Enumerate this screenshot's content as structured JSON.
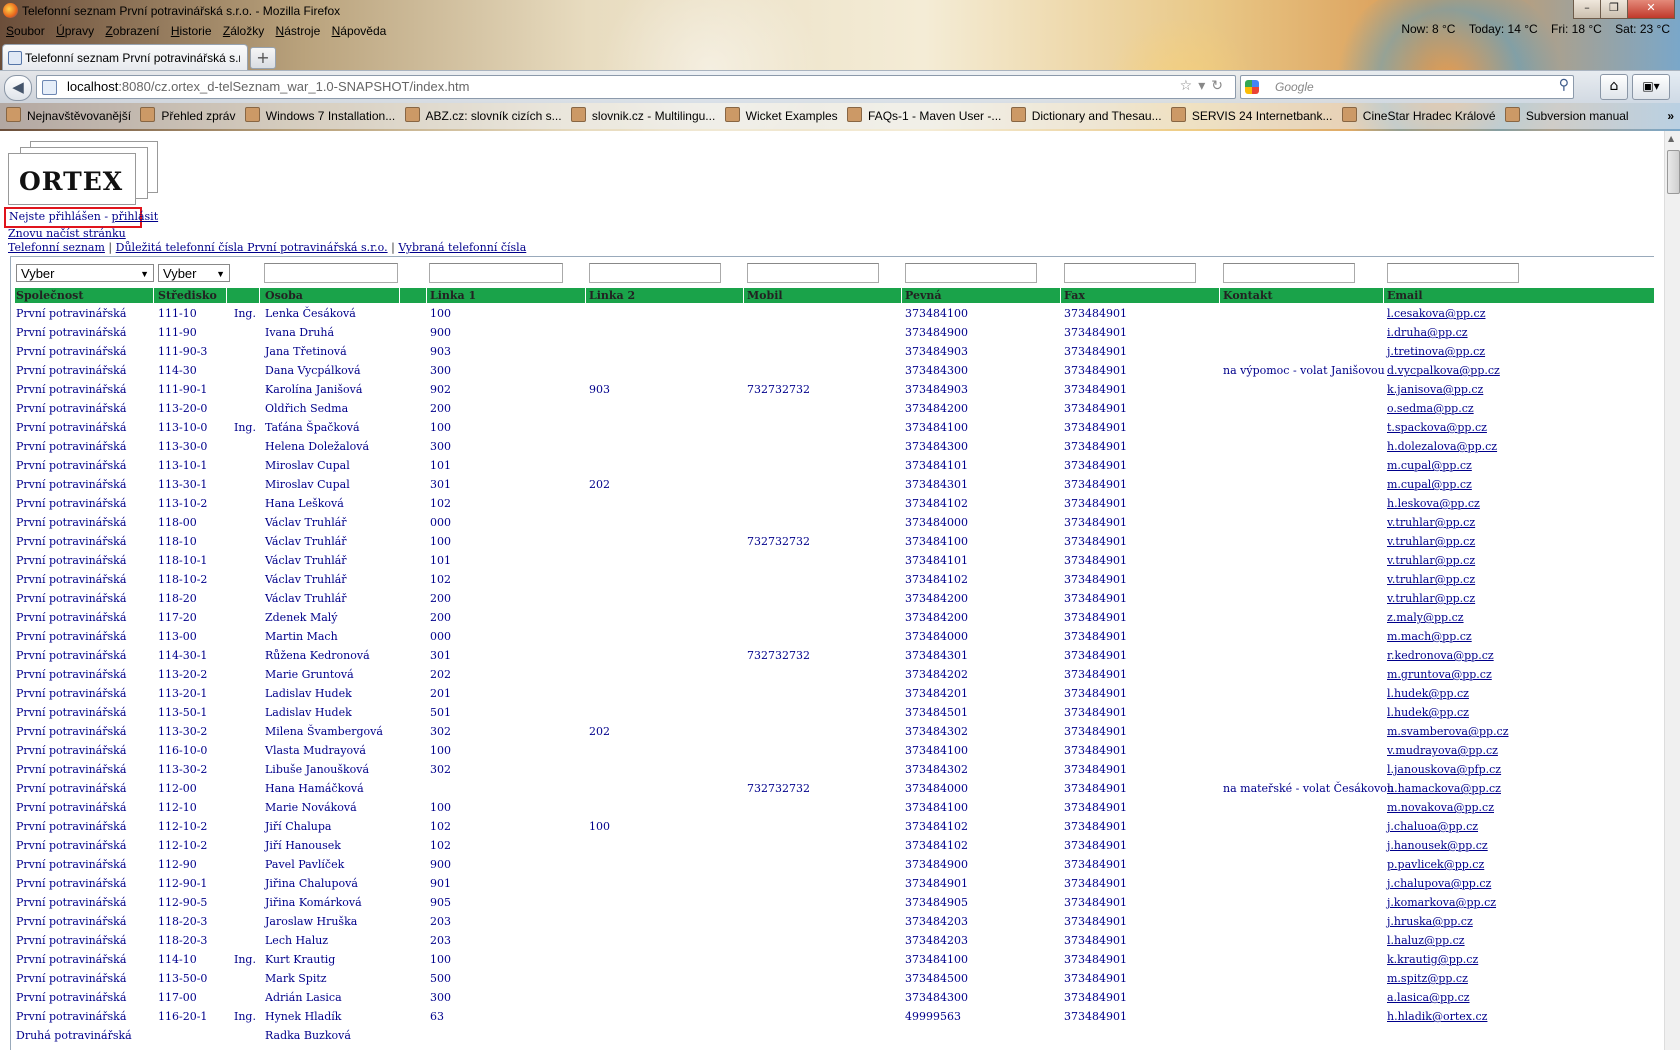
{
  "browser": {
    "window_title": "Telefonní seznam První potravinářská s.r.o. - Mozilla Firefox",
    "menu": [
      "Soubor",
      "Úpravy",
      "Zobrazení",
      "Historie",
      "Záložky",
      "Nástroje",
      "Nápověda"
    ],
    "weather": {
      "now": "Now: 8 °C",
      "today": "Today: 14 °C",
      "fri": "Fri: 18 °C",
      "sat": "Sat: 23 °C"
    },
    "tab_title": "Telefonní seznam První potravinářská s.r...",
    "new_tab": "+",
    "url_host": "localhost",
    "url_rest": ":8080/cz.ortex_d-telSeznam_war_1.0-SNAPSHOT/index.htm",
    "search_placeholder": "Google",
    "bookmarks": [
      "Nejnavštěvovanější",
      "Přehled zpráv",
      "Windows 7 Installation...",
      "ABZ.cz: slovník cizích s...",
      "slovnik.cz - Multilingu...",
      "Wicket Examples",
      "FAQs-1 - Maven User -...",
      "Dictionary and Thesau...",
      "SERVIS 24 Internetbank...",
      "CineStar Hradec Králové",
      "Subversion manual"
    ],
    "bookmarks_more": "»",
    "window_buttons": {
      "minimize": "–",
      "restore": "❐",
      "close": "✕"
    }
  },
  "page": {
    "logo_text": "ORTEX",
    "login_status": "Nejste přihlášen - ",
    "login_link": "přihlásit",
    "reload_link": "Znovu načíst stránku",
    "nav": [
      "Telefonní seznam",
      "Důležitá telefonní čísla První potravinářská s.r.o.",
      "Vybraná telefonní čísla"
    ],
    "nav_sep": "|",
    "filters": {
      "company": "Vyber",
      "center": "Vyber"
    },
    "headers": {
      "company": "Společnost",
      "center": "Středisko",
      "title": "",
      "person": "Osoba",
      "line1": "Linka 1",
      "line2": "Linka 2",
      "mobile": "Mobil",
      "landline": "Pevná",
      "fax": "Fax",
      "contact": "Kontakt",
      "email": "Email"
    },
    "rows": [
      [
        "První potravinářská",
        "111-10",
        "Ing.",
        "Lenka Česáková",
        "100",
        "",
        "",
        "373484100",
        "373484901",
        "",
        "l.cesakova@pp.cz"
      ],
      [
        "První potravinářská",
        "111-90",
        "",
        "Ivana Druhá",
        "900",
        "",
        "",
        "373484900",
        "373484901",
        "",
        "i.druha@pp.cz"
      ],
      [
        "První potravinářská",
        "111-90-3",
        "",
        "Jana Třetinová",
        "903",
        "",
        "",
        "373484903",
        "373484901",
        "",
        "j.tretinova@pp.cz"
      ],
      [
        "První potravinářská",
        "114-30",
        "",
        "Dana Vycpálková",
        "300",
        "",
        "",
        "373484300",
        "373484901",
        "na výpomoc - volat Janišovou",
        "d.vycpalkova@pp.cz"
      ],
      [
        "První potravinářská",
        "111-90-1",
        "",
        "Karolína Janišová",
        "902",
        "903",
        "732732732",
        "373484903",
        "373484901",
        "",
        "k.janisova@pp.cz"
      ],
      [
        "První potravinářská",
        "113-20-0",
        "",
        "Oldřich Sedma",
        "200",
        "",
        "",
        "373484200",
        "373484901",
        "",
        "o.sedma@pp.cz"
      ],
      [
        "První potravinářská",
        "113-10-0",
        "Ing.",
        "Taťána Špačková",
        "100",
        "",
        "",
        "373484100",
        "373484901",
        "",
        "t.spackova@pp.cz"
      ],
      [
        "První potravinářská",
        "113-30-0",
        "",
        "Helena Doležalová",
        "300",
        "",
        "",
        "373484300",
        "373484901",
        "",
        "h.dolezalova@pp.cz"
      ],
      [
        "První potravinářská",
        "113-10-1",
        "",
        "Miroslav Cupal",
        "101",
        "",
        "",
        "373484101",
        "373484901",
        "",
        "m.cupal@pp.cz"
      ],
      [
        "První potravinářská",
        "113-30-1",
        "",
        "Miroslav Cupal",
        "301",
        "202",
        "",
        "373484301",
        "373484901",
        "",
        "m.cupal@pp.cz"
      ],
      [
        "První potravinářská",
        "113-10-2",
        "",
        "Hana Lešková",
        "102",
        "",
        "",
        "373484102",
        "373484901",
        "",
        "h.leskova@pp.cz"
      ],
      [
        "První potravinářská",
        "118-00",
        "",
        "Václav Truhlář",
        "000",
        "",
        "",
        "373484000",
        "373484901",
        "",
        "v.truhlar@pp.cz"
      ],
      [
        "První potravinářská",
        "118-10",
        "",
        "Václav Truhlář",
        "100",
        "",
        "732732732",
        "373484100",
        "373484901",
        "",
        "v.truhlar@pp.cz"
      ],
      [
        "První potravinářská",
        "118-10-1",
        "",
        "Václav Truhlář",
        "101",
        "",
        "",
        "373484101",
        "373484901",
        "",
        "v.truhlar@pp.cz"
      ],
      [
        "První potravinářská",
        "118-10-2",
        "",
        "Václav Truhlář",
        "102",
        "",
        "",
        "373484102",
        "373484901",
        "",
        "v.truhlar@pp.cz"
      ],
      [
        "První potravinářská",
        "118-20",
        "",
        "Václav Truhlář",
        "200",
        "",
        "",
        "373484200",
        "373484901",
        "",
        "v.truhlar@pp.cz"
      ],
      [
        "První potravinářská",
        "117-20",
        "",
        "Zdenek Malý",
        "200",
        "",
        "",
        "373484200",
        "373484901",
        "",
        "z.maly@pp.cz"
      ],
      [
        "První potravinářská",
        "113-00",
        "",
        "Martin Mach",
        "000",
        "",
        "",
        "373484000",
        "373484901",
        "",
        "m.mach@pp.cz"
      ],
      [
        "První potravinářská",
        "114-30-1",
        "",
        "Růžena Kedronová",
        "301",
        "",
        "732732732",
        "373484301",
        "373484901",
        "",
        "r.kedronova@pp.cz"
      ],
      [
        "První potravinářská",
        "113-20-2",
        "",
        "Marie Gruntová",
        "202",
        "",
        "",
        "373484202",
        "373484901",
        "",
        "m.gruntova@pp.cz"
      ],
      [
        "První potravinářská",
        "113-20-1",
        "",
        "Ladislav Hudek",
        "201",
        "",
        "",
        "373484201",
        "373484901",
        "",
        "l.hudek@pp.cz"
      ],
      [
        "První potravinářská",
        "113-50-1",
        "",
        "Ladislav Hudek",
        "501",
        "",
        "",
        "373484501",
        "373484901",
        "",
        "l.hudek@pp.cz"
      ],
      [
        "První potravinářská",
        "113-30-2",
        "",
        "Milena Švambergová",
        "302",
        "202",
        "",
        "373484302",
        "373484901",
        "",
        "m.svamberova@pp.cz"
      ],
      [
        "První potravinářská",
        "116-10-0",
        "",
        "Vlasta Mudrayová",
        "100",
        "",
        "",
        "373484100",
        "373484901",
        "",
        "v.mudrayova@pp.cz"
      ],
      [
        "První potravinářská",
        "113-30-2",
        "",
        "Libuše Janoušková",
        "302",
        "",
        "",
        "373484302",
        "373484901",
        "",
        "l.janouskova@pfp.cz"
      ],
      [
        "První potravinářská",
        "112-00",
        "",
        "Hana Hamáčková",
        "",
        "",
        "732732732",
        "373484000",
        "373484901",
        "na mateřské - volat Česákovou",
        "h.hamackova@pp.cz"
      ],
      [
        "První potravinářská",
        "112-10",
        "",
        "Marie Nováková",
        "100",
        "",
        "",
        "373484100",
        "373484901",
        "",
        "m.novakova@pp.cz"
      ],
      [
        "První potravinářská",
        "112-10-2",
        "",
        "Jiří Chalupa",
        "102",
        "100",
        "",
        "373484102",
        "373484901",
        "",
        "j.chaluoa@pp.cz"
      ],
      [
        "První potravinářská",
        "112-10-2",
        "",
        "Jiří Hanousek",
        "102",
        "",
        "",
        "373484102",
        "373484901",
        "",
        "j.hanousek@pp.cz"
      ],
      [
        "První potravinářská",
        "112-90",
        "",
        "Pavel Pavlíček",
        "900",
        "",
        "",
        "373484900",
        "373484901",
        "",
        "p.pavlicek@pp.cz"
      ],
      [
        "První potravinářská",
        "112-90-1",
        "",
        "Jiřina Chalupová",
        "901",
        "",
        "",
        "373484901",
        "373484901",
        "",
        "j.chalupova@pp.cz"
      ],
      [
        "První potravinářská",
        "112-90-5",
        "",
        "Jiřina Komárková",
        "905",
        "",
        "",
        "373484905",
        "373484901",
        "",
        "j.komarkova@pp.cz"
      ],
      [
        "První potravinářská",
        "118-20-3",
        "",
        "Jaroslaw Hruška",
        "203",
        "",
        "",
        "373484203",
        "373484901",
        "",
        "j.hruska@pp.cz"
      ],
      [
        "První potravinářská",
        "118-20-3",
        "",
        "Lech Haluz",
        "203",
        "",
        "",
        "373484203",
        "373484901",
        "",
        "l.haluz@pp.cz"
      ],
      [
        "První potravinářská",
        "114-10",
        "Ing.",
        "Kurt Krautig",
        "100",
        "",
        "",
        "373484100",
        "373484901",
        "",
        "k.krautig@pp.cz"
      ],
      [
        "První potravinářská",
        "113-50-0",
        "",
        "Mark Spitz",
        "500",
        "",
        "",
        "373484500",
        "373484901",
        "",
        "m.spitz@pp.cz"
      ],
      [
        "První potravinářská",
        "117-00",
        "",
        "Adrián Lasica",
        "300",
        "",
        "",
        "373484300",
        "373484901",
        "",
        "a.lasica@pp.cz"
      ],
      [
        "První potravinářská",
        "116-20-1",
        "Ing.",
        "Hynek Hladík",
        "63",
        "",
        "",
        "49999563",
        "373484901",
        "",
        "h.hladik@ortex.cz"
      ],
      [
        "Druhá potravinářská",
        "",
        "",
        "Radka Buzková",
        "",
        "",
        "",
        "",
        "",
        "",
        ""
      ]
    ]
  }
}
